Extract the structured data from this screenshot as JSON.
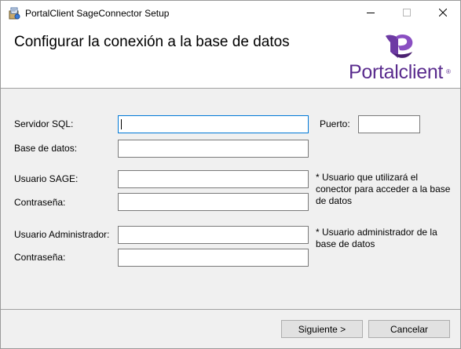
{
  "window": {
    "title": "PortalClient SageConnector Setup"
  },
  "banner": {
    "title": "Configurar la conexión a la base de datos",
    "logo_text": "Portalclient",
    "logo_mark": "®",
    "logo_color": "#5a2c8e"
  },
  "form": {
    "sql_server": {
      "label": "Servidor SQL:",
      "value": ""
    },
    "port": {
      "label": "Puerto:",
      "value": ""
    },
    "database": {
      "label": "Base de datos:",
      "value": ""
    },
    "sage_user": {
      "label": "Usuario SAGE:",
      "value": ""
    },
    "sage_password": {
      "label": "Contraseña:",
      "value": ""
    },
    "sage_note": "* Usuario que utilizará el conector para acceder a la base de datos",
    "admin_user": {
      "label": "Usuario Administrador:",
      "value": ""
    },
    "admin_password": {
      "label": "Contraseña:",
      "value": ""
    },
    "admin_note": "* Usuario administrador de la base de datos"
  },
  "buttons": {
    "next": "Siguiente >",
    "cancel": "Cancelar"
  },
  "icons": {
    "app": "setup-package-icon",
    "minimize": "minimize-icon",
    "maximize": "maximize-icon",
    "close": "close-icon",
    "logo": "portalclient-logo-mark"
  },
  "colors": {
    "accent_focus": "#0078d7",
    "brand": "#5a2c8e"
  }
}
